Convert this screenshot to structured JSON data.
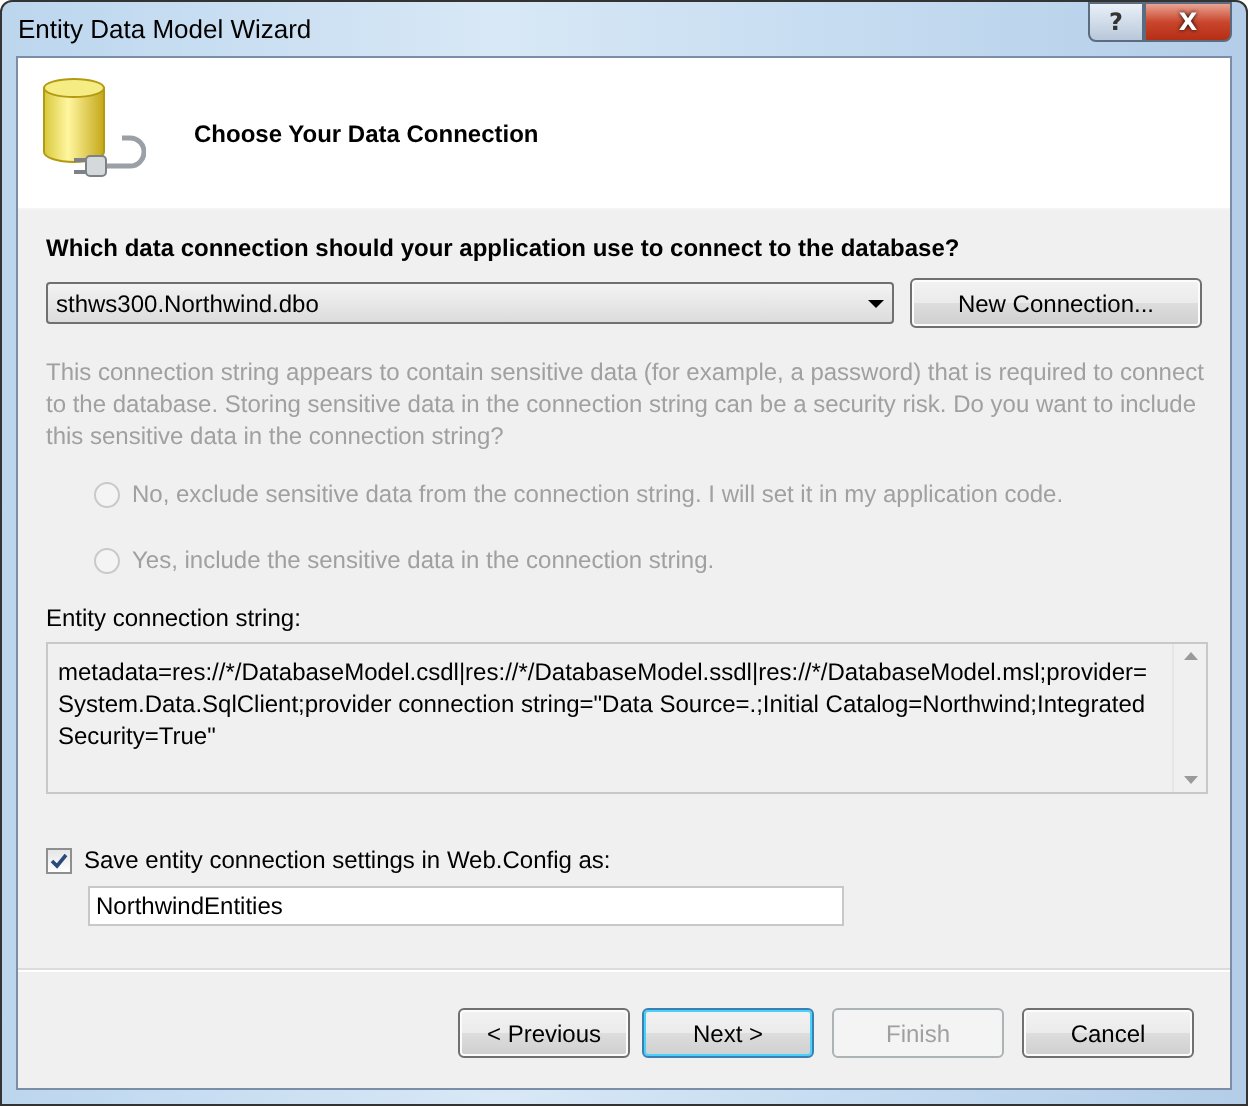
{
  "window": {
    "title": "Entity Data Model Wizard",
    "help_button": "?",
    "close_button": "X"
  },
  "header": {
    "title": "Choose Your Data Connection"
  },
  "connection": {
    "question": {
      "label": "Which data connection should your application use to connect to the database?"
    },
    "combo": {
      "value": "sthws300.Northwind.dbo"
    },
    "new_button": {
      "label": "New Connection...",
      "disabled": false
    }
  },
  "sensitive": {
    "disabled": true,
    "text": "This connection string appears to contain sensitive data (for example, a password) that is required to connect to the database. Storing sensitive data in the connection string can be a security risk. Do you want to include this sensitive data in the connection string?",
    "options": [
      {
        "label": "No, exclude sensitive data from the connection string. I will set it in my application code.",
        "selected": false,
        "disabled": true
      },
      {
        "label": "Yes, include the sensitive data in the connection string.",
        "selected": false,
        "disabled": true
      }
    ]
  },
  "entity_string": {
    "label": "Entity connection string:",
    "value": "metadata=res://*/DatabaseModel.csdl|res://*/DatabaseModel.ssdl|res://*/DatabaseModel.msl;provider=System.Data.SqlClient;provider connection string=\"Data Source=.;Initial Catalog=Northwind;Integrated Security=True\""
  },
  "save": {
    "label": "Save entity connection settings in Web.Config as:",
    "checked": true,
    "value": "NorthwindEntities"
  },
  "buttons": [
    {
      "label": "< Previous",
      "disabled": false,
      "default": false
    },
    {
      "label": "Next >",
      "disabled": false,
      "default": true
    },
    {
      "label": "Finish",
      "disabled": true,
      "default": false
    },
    {
      "label": "Cancel",
      "disabled": false,
      "default": false
    }
  ]
}
